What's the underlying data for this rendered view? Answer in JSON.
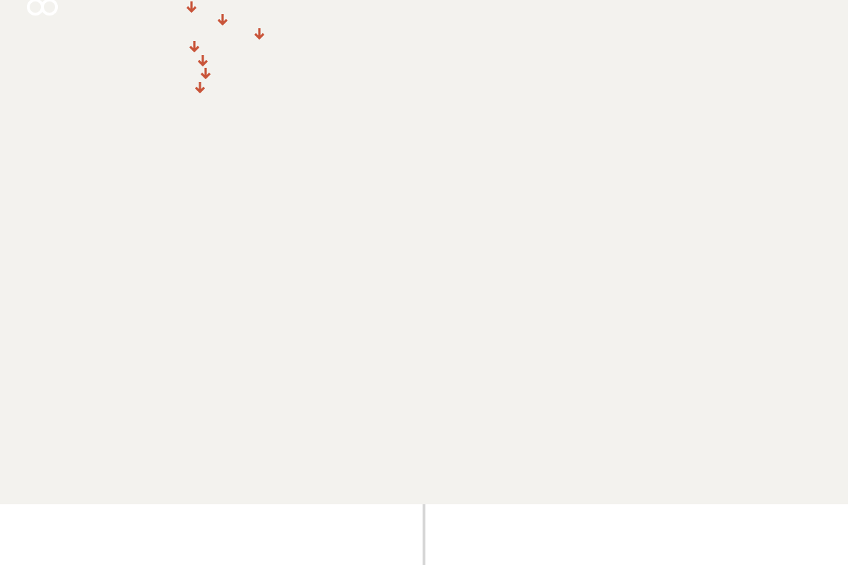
{
  "nav": [
    {
      "kind": "dropdown"
    },
    {
      "kind": "dropdown"
    },
    {
      "kind": "dropdown"
    },
    {
      "kind": "dropdown"
    },
    {
      "kind": "dropdown"
    },
    {
      "kind": "dropdown"
    },
    {
      "kind": "dropdown"
    }
  ]
}
